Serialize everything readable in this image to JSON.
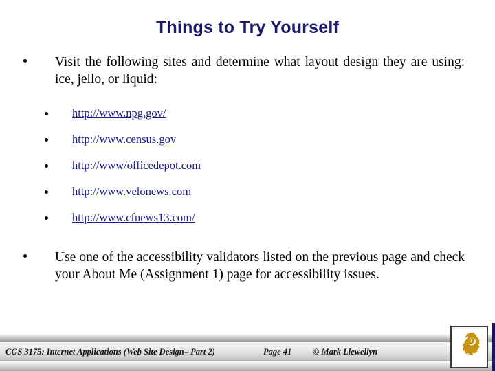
{
  "slide": {
    "title": "Things to Try Yourself",
    "bullets": [
      {
        "level": 1,
        "text": "Visit the following sites and determine what layout design they are using: ice, jello, or liquid:"
      },
      {
        "level": 1,
        "text": "Use one of the accessibility validators listed on the previous page and check your About Me (Assignment 1) page for accessibility issues."
      }
    ],
    "links": [
      {
        "label": "http://www.npg.gov/"
      },
      {
        "label": "http://www.census.gov"
      },
      {
        "label": "http://www/officedepot.com"
      },
      {
        "label": "http://www.velonews.com"
      },
      {
        "label": "http://www.cfnews13.com/"
      }
    ]
  },
  "footer": {
    "course": "CGS 3175: Internet Applications (Web Site Design– Part 2)",
    "page": "Page 41",
    "copyright": "© Mark Llewellyn"
  },
  "logo": {
    "name": "ucf-pegasus-logo",
    "color": "#C69214"
  },
  "colors": {
    "title": "#1a1a6e",
    "link": "#1a1a8c",
    "body_text": "#000000",
    "background": "#ffffff",
    "accent_edge": "#14146e"
  }
}
